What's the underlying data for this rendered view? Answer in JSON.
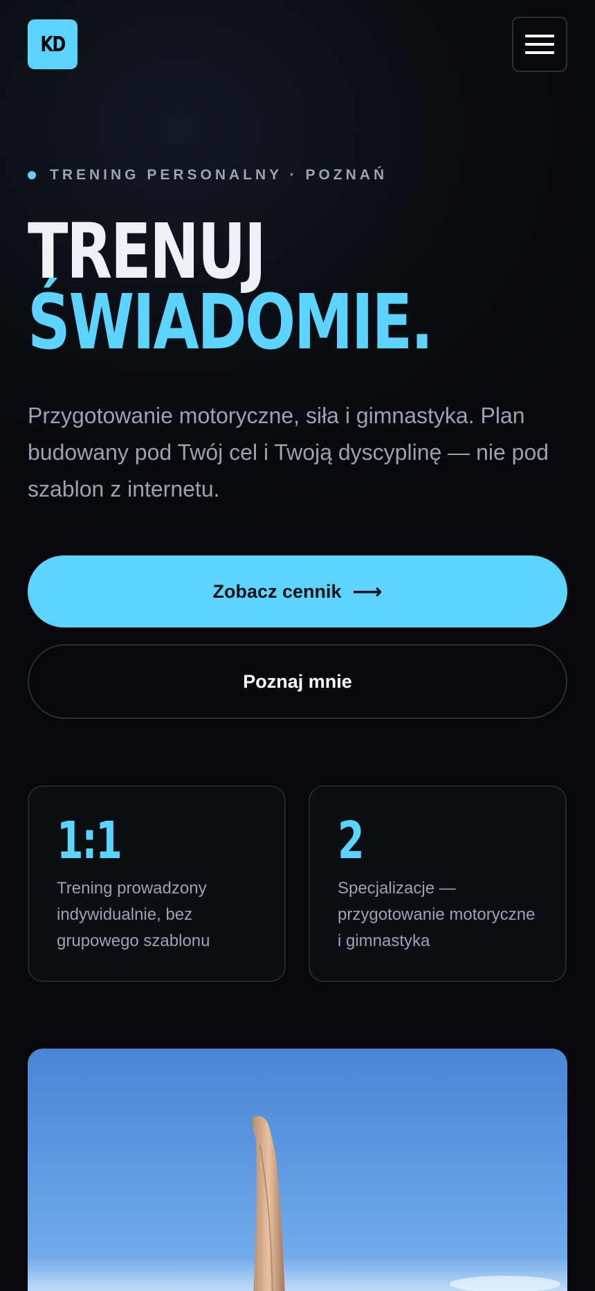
{
  "header": {
    "logo_text": "KD",
    "menu_icon": "hamburger-menu-icon"
  },
  "hero": {
    "eyebrow": "TRENING PERSONALNY · POZNAŃ",
    "title_line1": "TRENUJ",
    "title_line2": "ŚWIADOMIE.",
    "lead": "Przygotowanie motoryczne, siła i gimnastyka. Plan budowany pod Twój cel i Twoją dyscyplinę — nie pod szablon z internetu.",
    "cta_primary": "Zobacz cennik",
    "cta_primary_icon": "arrow-right-icon",
    "cta_secondary": "Poznaj mnie"
  },
  "stats": [
    {
      "value": "1:1",
      "label": "Trening prowadzony indywidualnie, bez grupowego szablonu"
    },
    {
      "value": "2",
      "label": "Specjalizacje — przygotowanie motoryczne i gimnastyka"
    }
  ],
  "colors": {
    "accent": "#5dd3ff",
    "background": "#07090d",
    "muted_text": "#9aa3b0"
  }
}
